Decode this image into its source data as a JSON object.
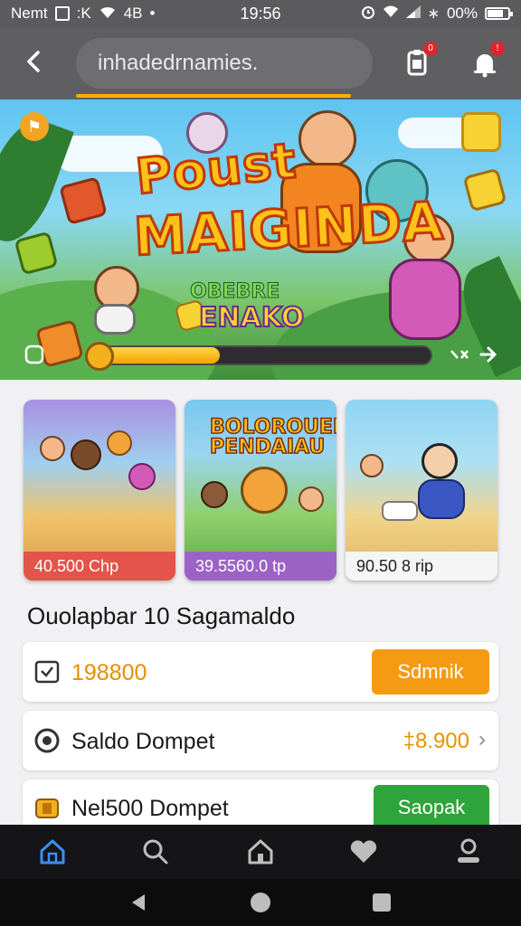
{
  "status_bar": {
    "carrier": "Nemt",
    "network_icons": ":K",
    "signal_text": "4B",
    "dot": "•",
    "time": "19:56",
    "battery": "00%"
  },
  "header": {
    "search_text": "inhadedrnamies.",
    "back_icon": "back-arrow-icon",
    "clipboard_icon": "clipboard-icon",
    "bell_icon": "bell-icon",
    "badge_1": "0",
    "badge_2": "!"
  },
  "banner": {
    "title_line1": "Poust",
    "title_line2": "MAIGINDA",
    "subtitle_line1": "OBEBRE",
    "subtitle_line2": "ENAKO",
    "progress": 0.38
  },
  "games": [
    {
      "price": "40.500 Chp",
      "color": "#e4544a"
    },
    {
      "title": "BOLOROUEL PENDAIAU",
      "price": "39.5560.0 tp",
      "color": "#9c63c6"
    },
    {
      "price": "90.50 8 rip",
      "color": "#f5f5f5"
    }
  ],
  "section": {
    "title": "Ouolapbar 10 Sagamaldo"
  },
  "rows": [
    {
      "label": "198800",
      "button": "Sdmnik",
      "icon": "calendar-icon",
      "button_color": "#f59b12",
      "label_color": "#e58e00"
    },
    {
      "label": "Saldo Dompet",
      "value": "‡8.900",
      "icon": "wallet-icon"
    },
    {
      "label": "Nel500 Dompet",
      "button": "Saopak",
      "icon": "gift-icon",
      "button_color": "#2ea43a"
    }
  ],
  "bottom_nav": [
    {
      "icon": "home-icon",
      "active": true
    },
    {
      "icon": "search-icon"
    },
    {
      "icon": "house-icon"
    },
    {
      "icon": "heart-icon"
    },
    {
      "icon": "profile-icon"
    }
  ],
  "colors": {
    "accent": "#f4b300",
    "nav_active": "#3b8ff5"
  }
}
